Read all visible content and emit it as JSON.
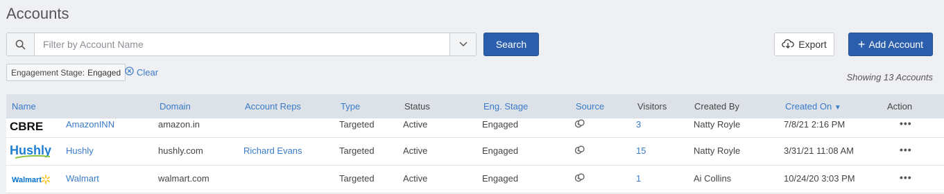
{
  "page": {
    "title": "Accounts"
  },
  "search": {
    "placeholder": "Filter by Account Name",
    "value": "",
    "button_label": "Search"
  },
  "actions": {
    "export_label": "Export",
    "add_label": "Add Account"
  },
  "filter": {
    "chip_key": "Engagement Stage:",
    "chip_value": "Engaged",
    "clear_label": "Clear"
  },
  "summary": {
    "showing": "Showing 13 Accounts"
  },
  "table": {
    "columns": [
      "Name",
      "Domain",
      "Account Reps",
      "Type",
      "Status",
      "Eng. Stage",
      "Source",
      "Visitors",
      "Created By",
      "Created On",
      "Action"
    ],
    "rows": [
      {
        "logo": "CBRE",
        "name": "AmazonINN",
        "domain": "amazon.in",
        "reps": "",
        "type": "Targeted",
        "status": "Active",
        "stage": "Engaged",
        "visitors": "3",
        "created_by": "Natty Royle",
        "created_on": "7/8/21 2:16 PM",
        "action": "•••"
      },
      {
        "logo": "Hushly",
        "name": "Hushly",
        "domain": "hushly.com",
        "reps": "Richard Evans",
        "type": "Targeted",
        "status": "Active",
        "stage": "Engaged",
        "visitors": "15",
        "created_by": "Natty Royle",
        "created_on": "3/31/21 11:08 AM",
        "action": "•••"
      },
      {
        "logo": "Walmart",
        "name": "Walmart",
        "domain": "walmart.com",
        "reps": "",
        "type": "Targeted",
        "status": "Active",
        "stage": "Engaged",
        "visitors": "1",
        "created_by": "Ai Collins",
        "created_on": "10/24/20 3:03 PM",
        "action": "•••"
      }
    ]
  },
  "colors": {
    "primary": "#2b5fad",
    "link": "#3a7bc8",
    "header_bg": "#dde1e8",
    "page_bg": "#eef0f4"
  }
}
